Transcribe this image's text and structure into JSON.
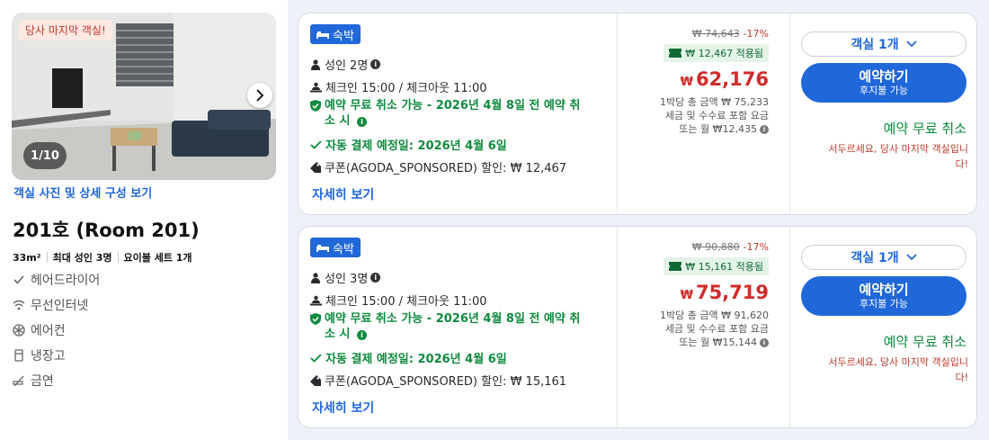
{
  "room": {
    "last_room_tag": "당사 마지막 객실!",
    "image_counter": "1/10",
    "photos_link": "객실 사진 및 상세 구성 보기",
    "title": "201호 (Room 201)",
    "specs": {
      "size": "33m²",
      "max_occupancy": "최대 성인 3명",
      "bedding": "요이불 세트 1개"
    },
    "amenities": [
      {
        "icon": "check-icon",
        "label": "헤어드라이어"
      },
      {
        "icon": "wifi-icon",
        "label": "무선인터넷"
      },
      {
        "icon": "snowflake-icon",
        "label": "에어컨"
      },
      {
        "icon": "fridge-icon",
        "label": "냉장고"
      },
      {
        "icon": "no-smoking-icon",
        "label": "금연"
      }
    ]
  },
  "offers": [
    {
      "badge": "숙박",
      "guests": "성인 2명",
      "checkin": "체크인 15:00 / 체크아웃 11:00",
      "cancel_line1": "예약 무료 취소 가능 - 2026년 4월 8일 전 예약 취",
      "cancel_line2": "소 시",
      "autopay": "자동 결제 예정일: 2026년 4월 6일",
      "coupon": "쿠폰(AGODA_SPONSORED) 할인: ₩ 12,467",
      "details_link": "자세히 보기",
      "original_price": "₩ 74,643",
      "discount_pct": "-17%",
      "applied": "₩ 12,467 적용됨",
      "currency": "₩",
      "price": "62,176",
      "per_night_total": "1박당 총 금액 ₩ 75,233",
      "tax_note": "세금 및 수수료 포함 요금",
      "monthly": "또는 월 ₩12,435",
      "room_select": "객실 1개",
      "book_label": "예약하기",
      "book_sub": "후지불 가능",
      "free_cancel": "예약 무료 취소",
      "hurry_line1": "서두르세요, 당사 마지막 객실입니",
      "hurry_line2": "다!"
    },
    {
      "badge": "숙박",
      "guests": "성인 3명",
      "checkin": "체크인 15:00 / 체크아웃 11:00",
      "cancel_line1": "예약 무료 취소 가능 - 2026년 4월 8일 전 예약 취",
      "cancel_line2": "소 시",
      "autopay": "자동 결제 예정일: 2026년 4월 6일",
      "coupon": "쿠폰(AGODA_SPONSORED) 할인: ₩ 15,161",
      "details_link": "자세히 보기",
      "original_price": "₩ 90,880",
      "discount_pct": "-17%",
      "applied": "₩ 15,161 적용됨",
      "currency": "₩",
      "price": "75,719",
      "per_night_total": "1박당 총 금액 ₩ 91,620",
      "tax_note": "세금 및 수수료 포함 요금",
      "monthly": "또는 월 ₩15,144",
      "room_select": "객실 1개",
      "book_label": "예약하기",
      "book_sub": "후지불 가능",
      "free_cancel": "예약 무료 취소",
      "hurry_line1": "서두르세요, 당사 마지막 객실입니",
      "hurry_line2": "다!"
    }
  ],
  "colors": {
    "accent": "#2067da",
    "price_red": "#d12c2c",
    "green": "#0f8a3e",
    "panel_bg": "#eef1f7"
  }
}
